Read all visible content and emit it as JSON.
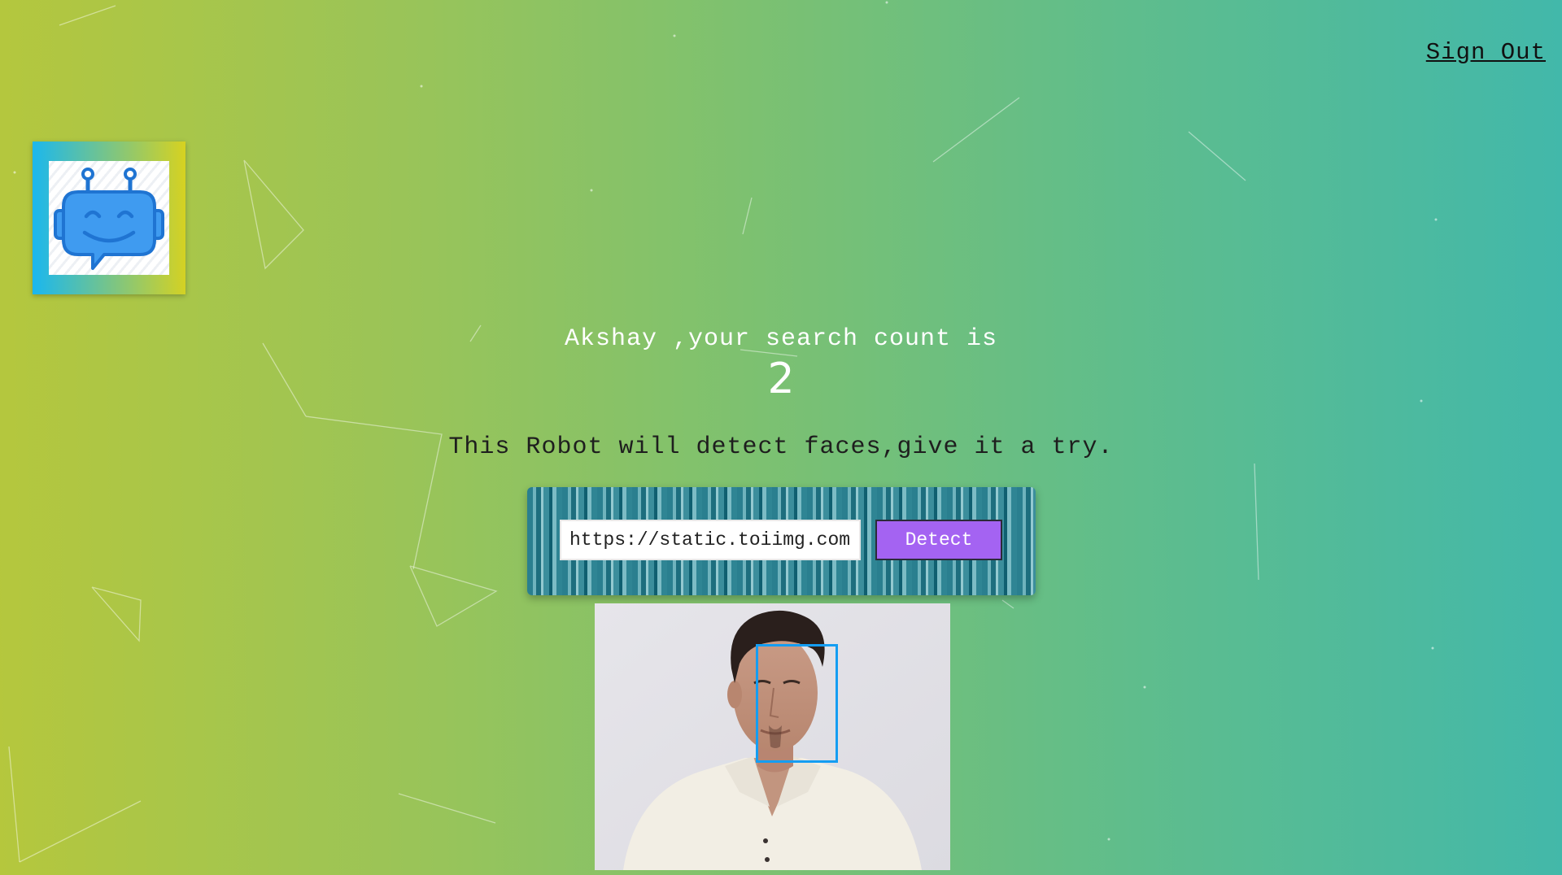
{
  "header": {
    "sign_out_label": "Sign Out"
  },
  "logo": {
    "icon": "robot-chat-icon",
    "frame_gradient": [
      "#19b7f0",
      "#d7d220"
    ]
  },
  "main": {
    "greeting": "Akshay ,your search count is",
    "search_count": "2",
    "tagline": "This Robot will detect faces,give it a try."
  },
  "form": {
    "url_value": "https://static.toiimg.com",
    "detect_label": "Detect"
  },
  "result": {
    "faces_detected": 1,
    "face_box_color": "#149df2"
  },
  "colors": {
    "background_start": "#b5c73d",
    "background_end": "#42b8aa",
    "button": "#a463f2"
  }
}
